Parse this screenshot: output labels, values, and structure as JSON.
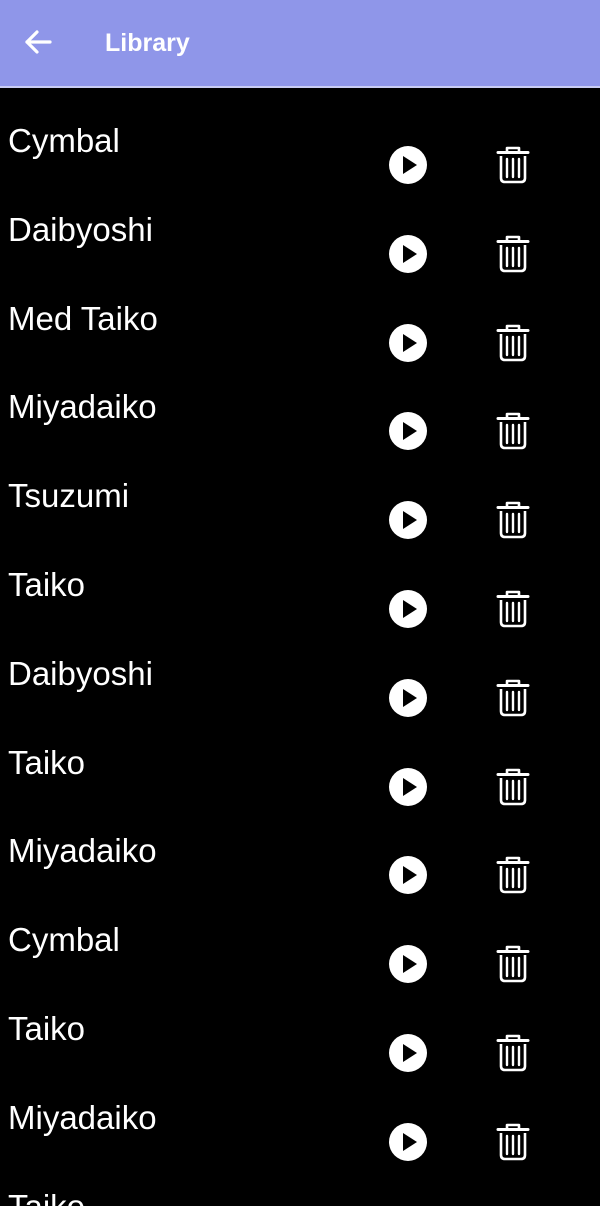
{
  "app_bar": {
    "title": "Library",
    "back_icon": "arrow-left-icon",
    "background": "#8f96e9"
  },
  "library": {
    "play_icon": "play-circle-icon",
    "delete_icon": "trash-icon",
    "items": [
      {
        "label": "Cymbal"
      },
      {
        "label": "Daibyoshi"
      },
      {
        "label": "Med Taiko"
      },
      {
        "label": "Miyadaiko"
      },
      {
        "label": "Tsuzumi"
      },
      {
        "label": "Taiko"
      },
      {
        "label": "Daibyoshi"
      },
      {
        "label": "Taiko"
      },
      {
        "label": "Miyadaiko"
      },
      {
        "label": "Cymbal"
      },
      {
        "label": "Taiko"
      },
      {
        "label": "Miyadaiko"
      },
      {
        "label": "Taiko"
      }
    ]
  }
}
